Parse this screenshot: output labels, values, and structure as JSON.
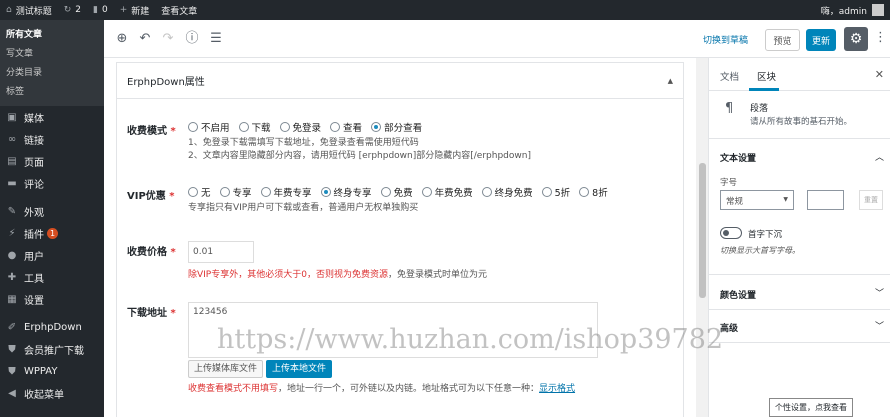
{
  "admin_bar": {
    "site_name": "测试标题",
    "updates_count": "2",
    "comments_count": "0",
    "new_label": "新建",
    "view_post": "查看文章",
    "greeting": "嗨，admin"
  },
  "sidebar": {
    "posts_sub": [
      "所有文章",
      "写文章",
      "分类目录",
      "标签"
    ],
    "items": [
      {
        "label": "媒体",
        "icon": "media-icon"
      },
      {
        "label": "链接",
        "icon": "link-icon"
      },
      {
        "label": "页面",
        "icon": "page-icon"
      },
      {
        "label": "评论",
        "icon": "comment-icon"
      },
      {
        "label": "外观",
        "icon": "appearance-icon"
      },
      {
        "label": "插件",
        "icon": "plugin-icon",
        "badge": "1"
      },
      {
        "label": "用户",
        "icon": "user-icon"
      },
      {
        "label": "工具",
        "icon": "tools-icon"
      },
      {
        "label": "设置",
        "icon": "settings-icon"
      },
      {
        "label": "ErphpDown",
        "icon": "erphpdown-icon"
      },
      {
        "label": "会员推广下载",
        "icon": "promo-icon"
      },
      {
        "label": "WPPAY",
        "icon": "wppay-icon"
      },
      {
        "label": "收起菜单",
        "icon": "collapse-icon"
      }
    ]
  },
  "toolbar": {
    "switch_editor": "切换到草稿",
    "preview": "预览",
    "update": "更新"
  },
  "metabox": {
    "title": "ErphpDown属性",
    "fee_mode": {
      "label": "收费模式",
      "options": [
        "不启用",
        "下载",
        "免登录",
        "查看",
        "部分查看"
      ],
      "selected": "部分查看",
      "hint1": "1、免登录下载需填写下载地址，免登录查看需使用短代码",
      "hint2": "2、文章内容里隐藏部分内容，请用短代码 [erphpdown]部分隐藏内容[/erphpdown]"
    },
    "vip": {
      "label": "VIP优惠",
      "options": [
        "无",
        "专享",
        "年费专享",
        "终身专享",
        "免费",
        "年费免费",
        "终身免费",
        "5折",
        "8折"
      ],
      "selected": "终身专享",
      "hint": "专享指只有VIP用户可下载或查看，普通用户无权单独购买"
    },
    "price": {
      "label": "收费价格",
      "value": "0.01",
      "warn": "除VIP专享外，其他必须大于0，否则视为免费资源",
      "warn_tail": "，免登录模式时单位为元"
    },
    "download": {
      "label": "下载地址",
      "value": "123456",
      "media_btn": "上传媒体库文件",
      "upload_btn": "上传本地文件",
      "warn": "收费查看模式不用填写",
      "warn_tail": "，地址一行一个，可外链以及内链。地址格式可为以下任意一种：",
      "link": "显示格式"
    }
  },
  "settings_panel": {
    "tab_doc": "文档",
    "tab_block": "区块",
    "block_name": "段落",
    "block_desc": "请从所有故事的基石开始。",
    "text_settings": "文本设置",
    "font_size_label": "字号",
    "font_size_value": "常规",
    "reset": "重置",
    "drop_cap": "首字下沉",
    "drop_cap_help": "切换显示大首写字母。",
    "color_settings": "颜色设置",
    "advanced": "高级"
  },
  "tooltip": "个性设置，点我查看",
  "watermark": "https://www.huzhan.com/ishop39782"
}
